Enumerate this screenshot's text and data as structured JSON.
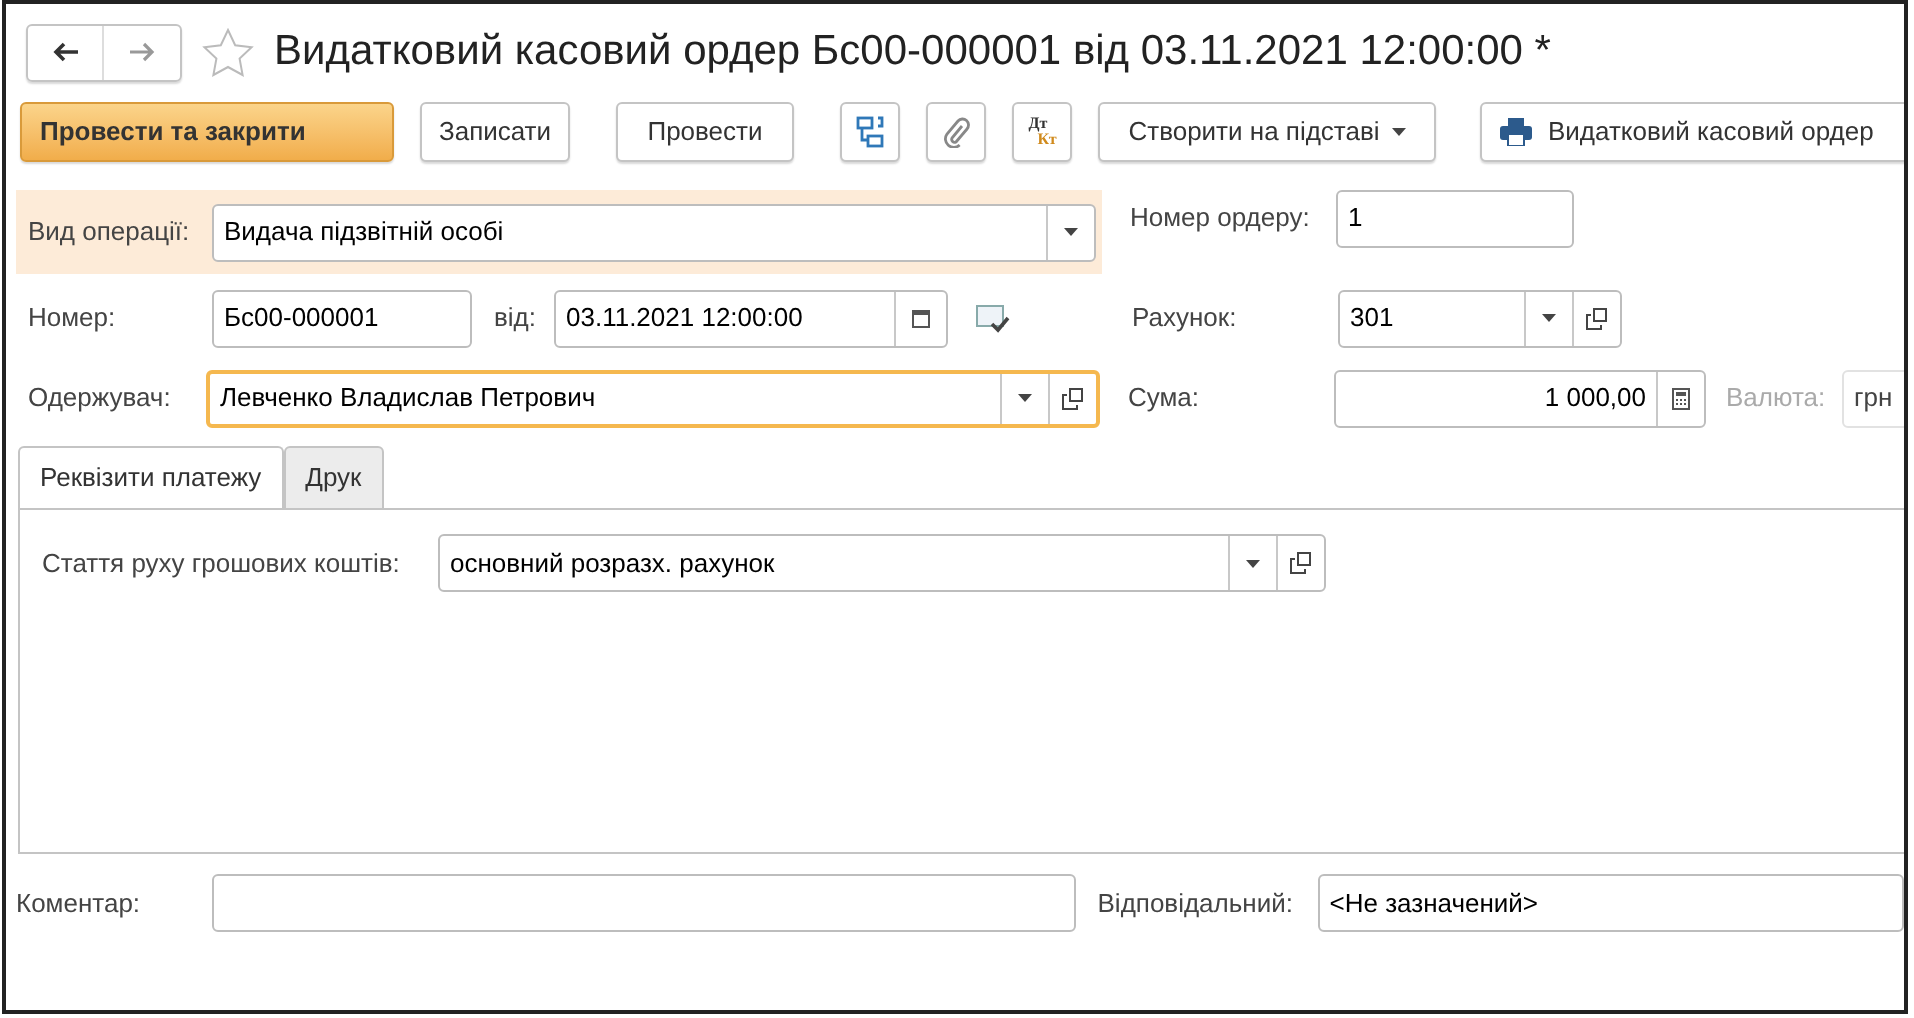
{
  "window": {
    "title": "Видатковий касовий ордер Бс00-000001 від 03.11.2021 12:00:00 *",
    "starred": false
  },
  "toolbar": [
    {
      "kind": "primary",
      "label": "Провести та закрити"
    },
    {
      "kind": "button",
      "label": "Записати"
    },
    {
      "kind": "button",
      "label": "Провести"
    },
    {
      "kind": "structure"
    },
    {
      "kind": "attach"
    },
    {
      "kind": "dtkt",
      "top": "Дт",
      "bottom": "Кт"
    },
    {
      "kind": "menu",
      "label": "Створити на підставі"
    },
    {
      "kind": "print",
      "label": "Видатковий касовий ордер"
    }
  ],
  "operation": {
    "label": "Вид операції:",
    "value": "Видача підзвітній особі"
  },
  "order_number": {
    "label": "Номер ордеру:",
    "value": "1"
  },
  "number": {
    "label": "Номер:",
    "value": "Бс00-000001"
  },
  "date": {
    "label": "від:",
    "value": "03.11.2021 12:00:00"
  },
  "account": {
    "label": "Рахунок:",
    "value": "301"
  },
  "recipient": {
    "label": "Одержувач:",
    "value": "Левченко Владислав Петрович",
    "focused": true
  },
  "sum": {
    "label": "Сума:",
    "value": "1 000,00"
  },
  "currency": {
    "label": "Валюта:",
    "value": "грн",
    "disabled": true
  },
  "tabs": [
    {
      "label": "Реквізити платежу",
      "selected": true
    },
    {
      "label": "Друк",
      "selected": false
    }
  ],
  "cash_flow_item": {
    "label": "Стаття руху грошових коштів:",
    "value": "основний розразх. рахунок"
  },
  "comment": {
    "label": "Коментар:"
  },
  "responsible": {
    "label": "Відповідальний:",
    "value": "<Не зазначений>"
  }
}
